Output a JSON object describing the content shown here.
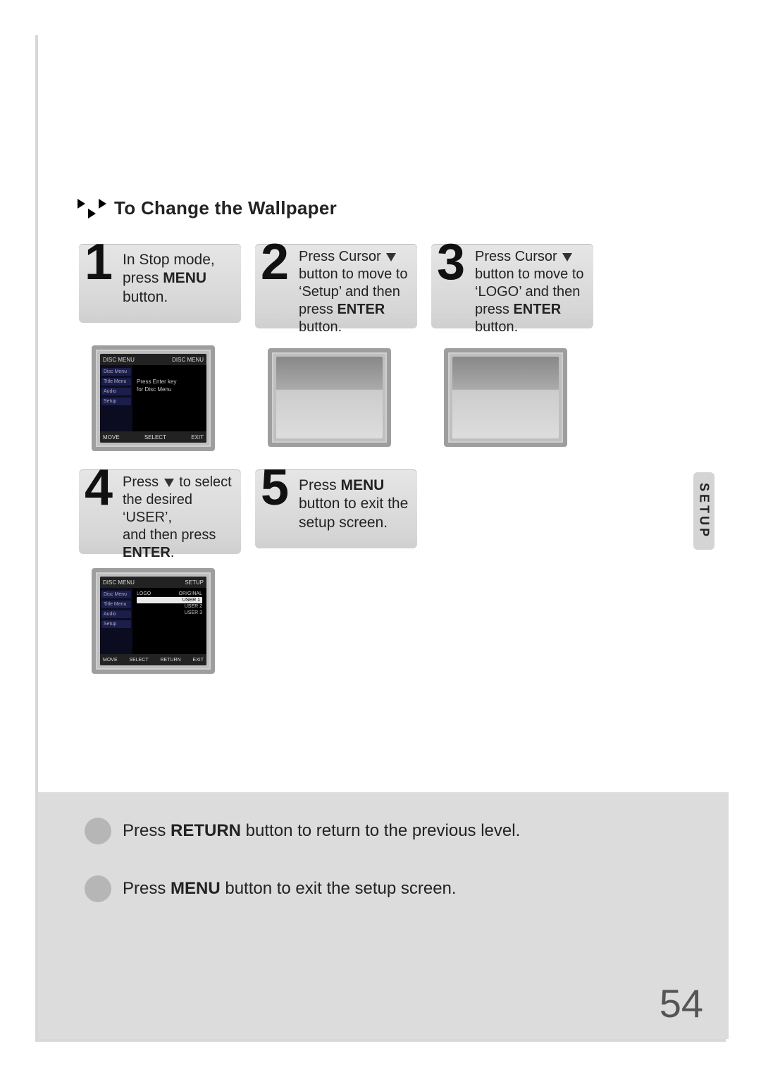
{
  "title": "To Change the Wallpaper",
  "side_tab": "SETUP",
  "page_number": "54",
  "steps": {
    "s1": {
      "num": "1",
      "l1": "In Stop mode,",
      "l2a": "press ",
      "l2b": "MENU",
      "l3": "button."
    },
    "s2": {
      "num": "2",
      "l1": "Press Cursor",
      "l2": "button to move to",
      "l3": "‘Setup’ and then",
      "l4a": "press ",
      "l4b": "ENTER",
      "l4c": " button."
    },
    "s3": {
      "num": "3",
      "l1": "Press Cursor",
      "l2": "button to move to",
      "l3": "‘LOGO’ and then",
      "l4a": "press ",
      "l4b": "ENTER",
      "l4c": " button."
    },
    "s4": {
      "num": "4",
      "l1a": "Press ",
      "l1b": " to select",
      "l2": "the desired ‘USER’,",
      "l3": "and then press",
      "l4": "ENTER",
      "l4b": "."
    },
    "s5": {
      "num": "5",
      "l1a": "Press ",
      "l1b": "MENU",
      "l2": "button to exit the",
      "l3": "setup screen."
    }
  },
  "shot1": {
    "top_left": "DISC MENU",
    "top_right": "DISC MENU",
    "side_items": [
      "Disc Menu",
      "Title Menu",
      "Audio",
      "Setup"
    ],
    "msg1": "Press Enter key",
    "msg2": "for Disc Menu",
    "bot_move": "MOVE",
    "bot_sel": "SELECT",
    "bot_exit": "EXIT"
  },
  "shot4": {
    "top_left": "DISC MENU",
    "top_right": "SETUP",
    "side_items": [
      "Disc Menu",
      "Title Menu",
      "Audio",
      "Setup"
    ],
    "col_label": "LOGO",
    "opts": [
      "ORIGINAL",
      "USER 1",
      "USER 2",
      "USER 3"
    ],
    "bot_move": "MOVE",
    "bot_sel": "SELECT",
    "bot_ret": "RETURN",
    "bot_exit": "EXIT"
  },
  "bottom": {
    "line1a": "Press ",
    "line1b": "RETURN",
    "line1c": " button to return to the previous level.",
    "line2a": "Press ",
    "line2b": "MENU",
    "line2c": " button to exit the setup screen."
  }
}
